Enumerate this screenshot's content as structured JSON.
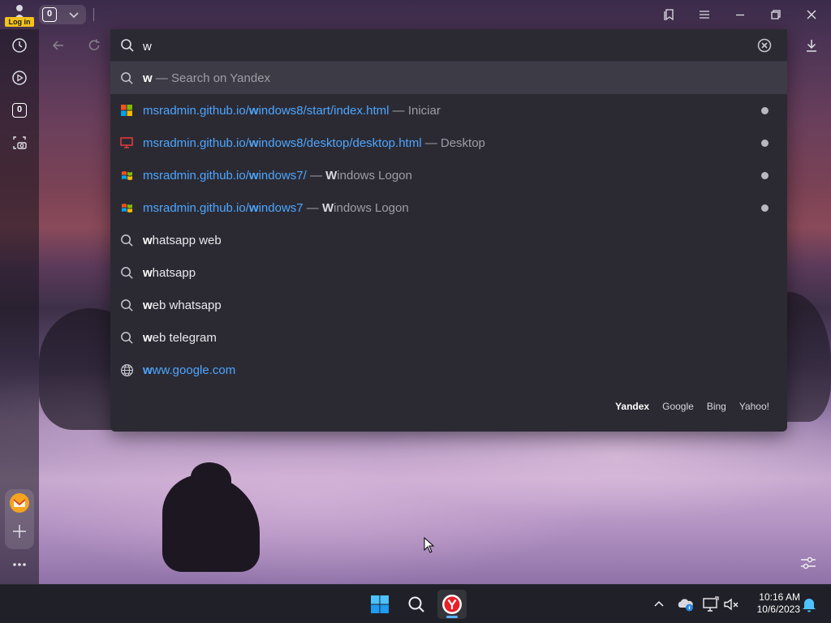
{
  "topbar": {
    "profile_badge": "Log in",
    "tab_count": "0"
  },
  "sidebar": {
    "tab_count": "0"
  },
  "omnibox": {
    "query": "w",
    "suggestions": [
      {
        "kind": "search",
        "icon": "search-icon",
        "bold": "w",
        "rest": " — Search on Yandex"
      },
      {
        "kind": "history",
        "icon": "windows8-favicon",
        "url_pre": "msradmin.github.io/",
        "url_bold": "w",
        "url_post": "indows8/start/index.html",
        "sep": " — ",
        "title_bold": "",
        "title": "Iniciar"
      },
      {
        "kind": "history",
        "icon": "monitor-favicon",
        "url_pre": "msradmin.github.io/",
        "url_bold": "w",
        "url_post": "indows8/desktop/desktop.html",
        "sep": " — ",
        "title_bold": "",
        "title": "Desktop"
      },
      {
        "kind": "history",
        "icon": "windows7-favicon",
        "url_pre": "msradmin.github.io/",
        "url_bold": "w",
        "url_post": "indows7/",
        "sep": " — ",
        "title_bold": "W",
        "title": "indows Logon"
      },
      {
        "kind": "history",
        "icon": "windows7-favicon",
        "url_pre": "msradmin.github.io/",
        "url_bold": "w",
        "url_post": "indows7",
        "sep": " — ",
        "title_bold": "W",
        "title": "indows Logon"
      },
      {
        "kind": "query",
        "icon": "search-icon",
        "bold": "w",
        "rest": "hatsapp web"
      },
      {
        "kind": "query",
        "icon": "search-icon",
        "bold": "w",
        "rest": "hatsapp"
      },
      {
        "kind": "query",
        "icon": "search-icon",
        "bold": "w",
        "rest": "eb whatsapp"
      },
      {
        "kind": "query",
        "icon": "search-icon",
        "bold": "w",
        "rest": "eb telegram"
      },
      {
        "kind": "site",
        "icon": "globe-icon",
        "bold": "w",
        "rest": "ww.google.com"
      }
    ],
    "engines": [
      "Yandex",
      "Google",
      "Bing",
      "Yahoo!"
    ],
    "active_engine": "Yandex"
  },
  "taskbar": {
    "time": "10:16 AM",
    "date": "10/6/2023"
  },
  "colors": {
    "url": "#4da6ff",
    "login_badge": "#f4c21a",
    "active_app_underline": "#5fb2ff"
  }
}
